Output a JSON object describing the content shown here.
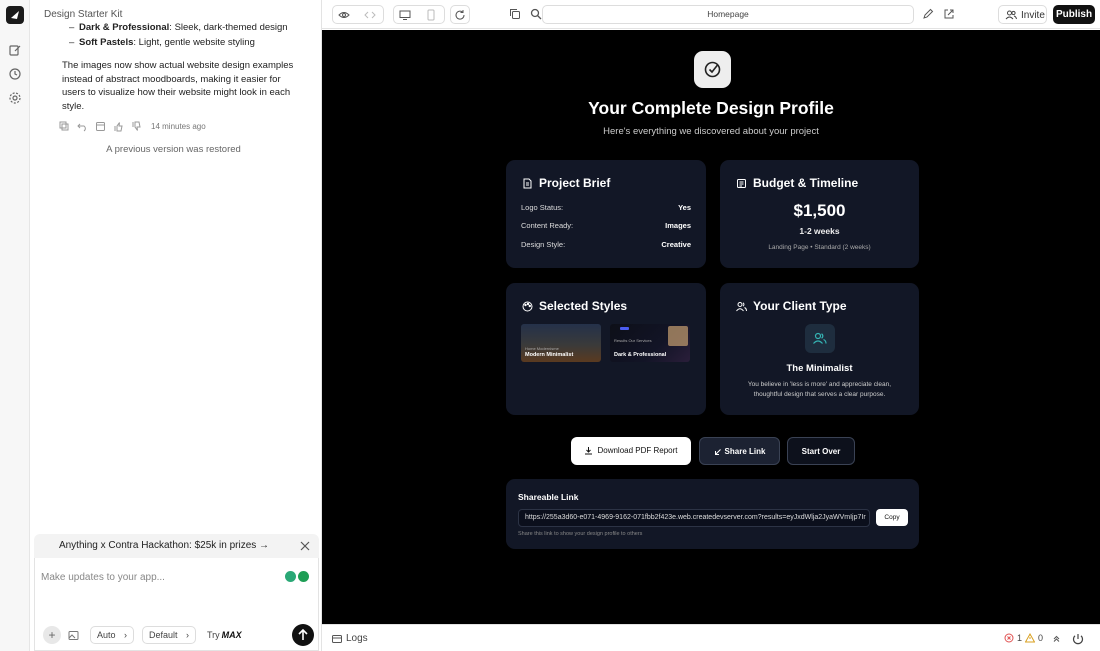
{
  "chat": {
    "title": "Design Starter Kit",
    "list_items": [
      {
        "bold": "Dark & Professional",
        "text": ": Sleek, dark-themed design"
      },
      {
        "bold": "Soft Pastels",
        "text": ": Light, gentle website styling"
      }
    ],
    "paragraph": "The images now show actual website design examples instead of abstract moodboards, making it easier for users to visualize how their website might look in each style.",
    "message_time": "14 minutes ago",
    "restored_notice": "A previous version was restored",
    "promo": "Anything x Contra Hackathon: $25k in prizes →",
    "input_placeholder": "Make updates to your app...",
    "mode_auto": "Auto",
    "mode_default": "Default",
    "try_label": "Try",
    "try_brand": "MAX"
  },
  "toolbar": {
    "url": "Homepage",
    "invite": "Invite",
    "publish": "Publish"
  },
  "preview": {
    "title": "Your Complete Design Profile",
    "subtitle": "Here's everything we discovered about your project",
    "brief": {
      "heading": "Project Brief",
      "rows": [
        {
          "label": "Logo Status:",
          "value": "Yes"
        },
        {
          "label": "Content Ready:",
          "value": "Images"
        },
        {
          "label": "Design Style:",
          "value": "Creative"
        }
      ]
    },
    "budget": {
      "heading": "Budget & Timeline",
      "price": "$1,500",
      "timeline": "1-2 weeks",
      "plan": "Landing Page • Standard (2 weeks)"
    },
    "styles": {
      "heading": "Selected Styles",
      "items": [
        "Modern Minimalist",
        "Dark & Professional"
      ]
    },
    "client": {
      "heading": "Your Client Type",
      "name": "The Minimalist",
      "description": "You believe in 'less is more' and appreciate clean, thoughtful design that serves a clear purpose."
    },
    "buttons": {
      "download": "Download PDF Report",
      "share": "Share Link",
      "restart": "Start Over"
    },
    "share": {
      "title": "Shareable Link",
      "url": "https://255a3d60-e071-4969-9162-071fbb2f423e.web.createdevserver.com?results=eyJxdWlja2JyaWVmIjp7Ir",
      "copy": "Copy",
      "hint": "Share this link to show your design profile to others"
    }
  },
  "bottombar": {
    "logs": "Logs",
    "errors": "1",
    "warnings": "0"
  },
  "colors": {
    "preview_bg": "#000000",
    "card_bg": "#121726",
    "accent_teal": "#35b4b4",
    "error_red": "#e05252",
    "warning_amber": "#d9a021"
  }
}
